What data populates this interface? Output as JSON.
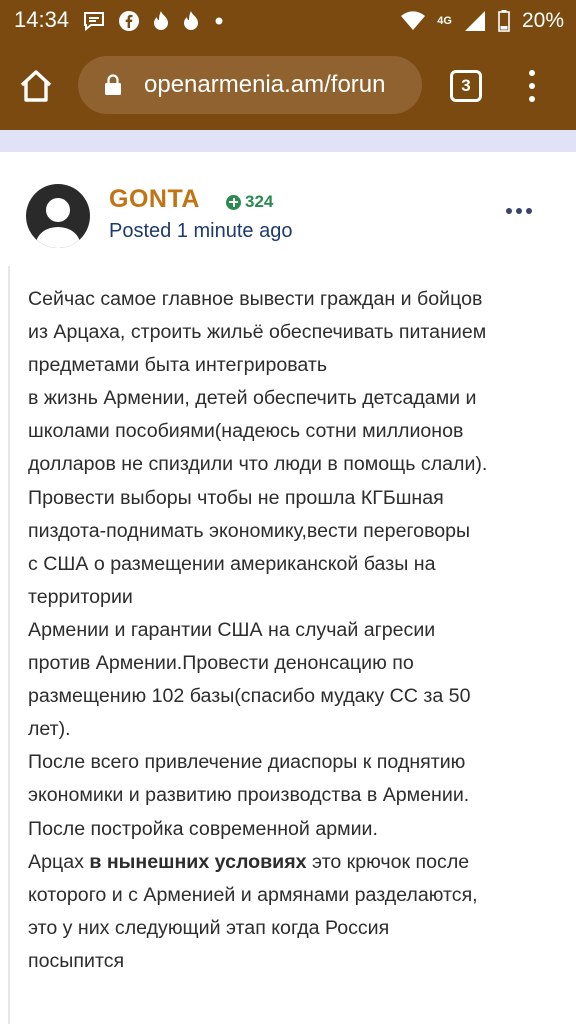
{
  "status_bar": {
    "time": "14:34",
    "network": "4G",
    "battery": "20%",
    "left_icons": [
      "message-icon",
      "facebook-icon",
      "tinder-icon",
      "tinder-icon",
      "dot-icon"
    ],
    "right_icons": [
      "wifi-icon",
      "network-4g-icon",
      "signal-icon",
      "battery-icon"
    ]
  },
  "browser": {
    "url": "openarmenia.am/forun",
    "tab_count": "3"
  },
  "post": {
    "author": "GONTA",
    "reputation": "324",
    "posted_label": "Posted",
    "posted_time": "1 minute ago",
    "lines": [
      "Сейчас самое главное вывести граждан и бойцов",
      "из Арцаха, строить жильё обеспечивать питанием",
      "предметами быта интегрировать",
      "в жизнь Армении, детей обеспечить детсадами и",
      "школами пособиями(надеюсь сотни миллионов",
      "долларов не спиздили что люди в помощь слали).",
      "Провести выборы чтобы не прошла КГБшная",
      "пиздота-поднимать экономику,вести переговоры",
      "с США о размещении американской базы на",
      "территории",
      "Армении и гарантии США на случай агресии",
      "против Армении.Провести денонсацию по",
      "размещению 102 базы(спасибо мудаку СС за  50",
      "лет).",
      "После всего привлечение диаспоры к поднятию",
      "экономики и развитию  производства в Армении.",
      "После постройка современной армии."
    ],
    "line_bold_prefix": "Арцах ",
    "line_bold": "в нынешних условиях",
    "line_bold_suffix": " это крючок после",
    "tail_lines": [
      "которого и с Арменией и армянами разделаются,",
      "это у них следующий этап когда Россия",
      "посыпится"
    ]
  },
  "colors": {
    "toolbar": "#7a4a10",
    "url_bar": "#8f6230",
    "author": "#c27414",
    "reputation": "#2a8a4f",
    "strip": "#e0e3f7"
  }
}
